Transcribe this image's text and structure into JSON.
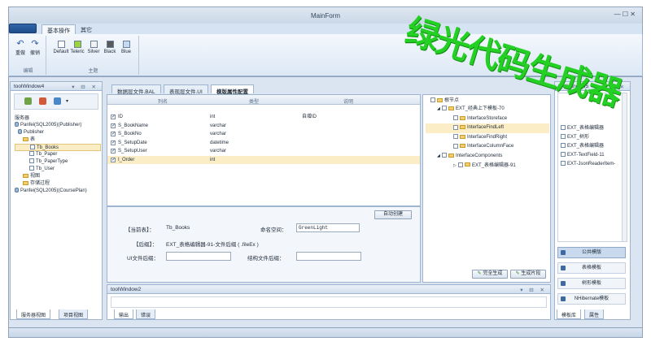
{
  "window": {
    "title": "MainForm",
    "controls": "—  ☐  ✕"
  },
  "ribbon": {
    "tabs": [
      "基本操作",
      "其它"
    ],
    "edit_group": {
      "name": "编辑",
      "undo": "重做",
      "redo": "撤销"
    },
    "theme_group": {
      "name": "主题",
      "items": [
        {
          "label": "Default",
          "color": "#ffffff"
        },
        {
          "label": "Teleric",
          "color": "#9bd43a"
        },
        {
          "label": "Silver",
          "color": "#f2f2f2"
        },
        {
          "label": "Black",
          "color": "#5a5a5a"
        },
        {
          "label": "Blue",
          "color": "#c6d9f1"
        }
      ]
    }
  },
  "left_panel": {
    "title": "toolWindow4",
    "controls": "▾ ⊟ ✕",
    "tree_root_label": "服务器",
    "tree": [
      {
        "label": "Panfei(SQL2005)(Publisher)",
        "type": "db"
      },
      {
        "label": "Publisher",
        "type": "db"
      },
      {
        "label": "表",
        "type": "folder"
      },
      {
        "label": "Tb_Books",
        "type": "table",
        "selected": true
      },
      {
        "label": "Tb_Paper",
        "type": "table"
      },
      {
        "label": "Tb_PaperType",
        "type": "table"
      },
      {
        "label": "Tb_User",
        "type": "table"
      },
      {
        "label": "视图",
        "type": "folder"
      },
      {
        "label": "存储过程",
        "type": "folder"
      },
      {
        "label": "Panfei(SQL2005)(CoursePlan)",
        "type": "db"
      }
    ],
    "bottom_tabs": [
      "服务器视图",
      "项目视图"
    ]
  },
  "doc_tabs": [
    "数据层文件.BAL",
    "表现层文件.UI",
    "模版属性配置"
  ],
  "grid": {
    "headers": [
      "列名",
      "类型",
      "说明"
    ],
    "rows": [
      {
        "name": "ID",
        "type": "int",
        "desc": "自增ID"
      },
      {
        "name": "S_BookName",
        "type": "varchar",
        "desc": ""
      },
      {
        "name": "S_BookNo",
        "type": "varchar",
        "desc": ""
      },
      {
        "name": "S_SetupDate",
        "type": "datetime",
        "desc": ""
      },
      {
        "name": "S_SetupUser",
        "type": "varchar",
        "desc": ""
      },
      {
        "name": "I_Order",
        "type": "int",
        "desc": ""
      }
    ]
  },
  "form": {
    "auto_create": "自动创建",
    "current_table_label": "【当前表】：",
    "current_table": "Tb_Books",
    "namespace_label": "命名空间：",
    "namespace_value": "GreenLight",
    "suffix_label": "【后缀】：",
    "suffix_value": "EXT_表格编辑器-91-文件后缀 ( .fileEx )",
    "ui_suffix_label": "UI文件后缀：",
    "struct_suffix_label": "结构文件后缀："
  },
  "template_tree": {
    "root": "根节点",
    "items": [
      {
        "label": "EXT_经典上下模板-70",
        "level": 1
      },
      {
        "label": "InterfaceStoreface",
        "level": 2
      },
      {
        "label": "InterfaceFindLeft",
        "level": 2,
        "selected": true
      },
      {
        "label": "InterfaceFindRight",
        "level": 2
      },
      {
        "label": "InterfaceColumnFace",
        "level": 2
      },
      {
        "label": "InterfaceComponents",
        "level": 1
      },
      {
        "label": "EXT_表格编辑器-91",
        "level": 2
      }
    ],
    "gen_all": "完全生成",
    "gen_part": "生成片段"
  },
  "output": {
    "title": "toolWindow2",
    "tabs": [
      "输出",
      "错误"
    ]
  },
  "right_panel": {
    "title": "toolWindow5",
    "items": [
      "EXT_表格编辑器",
      "EXT_树形",
      "EXT_表格编辑器",
      "EXT-TextField-11",
      "EXT-JsonReaderItem-"
    ],
    "cards": [
      "公共模版",
      "表格模板",
      "树形模板",
      "NHibernate模板"
    ],
    "bottom_tabs": [
      "模板库",
      "属性"
    ]
  },
  "watermark": "绿光代码生成器"
}
